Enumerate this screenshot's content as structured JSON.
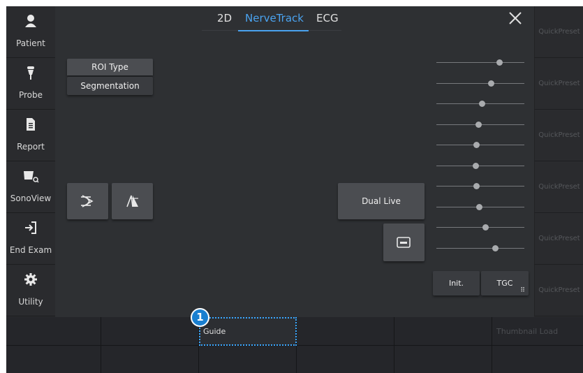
{
  "nav": {
    "items": [
      {
        "label": "Patient",
        "icon": "person-icon"
      },
      {
        "label": "Probe",
        "icon": "probe-icon"
      },
      {
        "label": "Report",
        "icon": "document-icon"
      },
      {
        "label": "SonoView",
        "icon": "sonoview-icon"
      },
      {
        "label": "End Exam",
        "icon": "exit-icon"
      },
      {
        "label": "Utility",
        "icon": "gear-icon"
      }
    ]
  },
  "tabs": [
    {
      "label": "2D"
    },
    {
      "label": "NerveTrack"
    },
    {
      "label": "ECG"
    }
  ],
  "active_tab": "NerveTrack",
  "controls": {
    "roi_type_label": "ROI Type",
    "segmentation_label": "Segmentation",
    "dual_live_label": "Dual Live",
    "init_label": "Init.",
    "tgc_label": "TGC"
  },
  "tgc_levels": [
    0.72,
    0.62,
    0.52,
    0.48,
    0.46,
    0.45,
    0.46,
    0.49,
    0.56,
    0.67
  ],
  "presets": [
    "QuickPreset",
    "QuickPreset",
    "QuickPreset",
    "QuickPreset",
    "QuickPreset",
    "QuickPreset"
  ],
  "bottom": {
    "guide_label": "Guide",
    "thumbnail_label": "Thumbnail Load",
    "badge": "1"
  },
  "colors": {
    "accent": "#4aa3f0",
    "background": "#2e3033",
    "button": "#4b4d51"
  }
}
